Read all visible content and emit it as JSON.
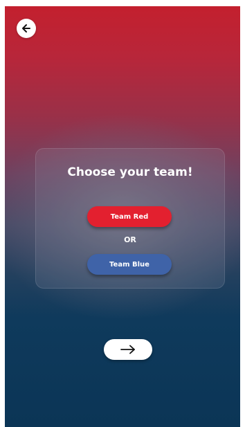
{
  "header": {
    "back_icon": "arrow-left-icon"
  },
  "team_card": {
    "title": "Choose your team!",
    "red_button_label": "Team Red",
    "separator": "OR",
    "blue_button_label": "Team Blue"
  },
  "footer": {
    "next_icon": "arrow-right-icon"
  },
  "colors": {
    "team_red": "#e3202f",
    "team_blue": "#3f63a8",
    "background_top": "#c3202e",
    "background_bottom": "#0b3556"
  }
}
